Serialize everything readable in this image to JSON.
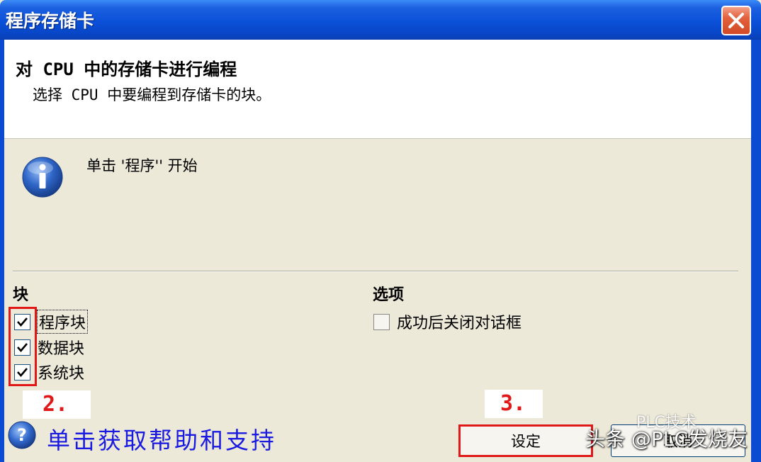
{
  "window": {
    "title": "程序存储卡"
  },
  "header": {
    "title": "对 CPU 中的存储卡进行编程",
    "subtitle": "选择 CPU 中要编程到存储卡的块。"
  },
  "info": {
    "message": "单击 '程序'' 开始"
  },
  "blocks": {
    "heading": "块",
    "items": [
      {
        "label": "程序块",
        "checked": true
      },
      {
        "label": "数据块",
        "checked": true
      },
      {
        "label": "系统块",
        "checked": true
      }
    ]
  },
  "options": {
    "heading": "选项",
    "close_on_success": {
      "label": "成功后关闭对话框",
      "checked": false
    }
  },
  "annotations": {
    "step2": "2.",
    "step3": "3.",
    "highlight_color": "#e01818"
  },
  "help": {
    "label": "单击获取帮助和支持"
  },
  "buttons": {
    "set": "设定",
    "cancel": "取消"
  },
  "watermark": {
    "line1": "头条 @PLC发烧友",
    "line2": "PLC技术"
  }
}
